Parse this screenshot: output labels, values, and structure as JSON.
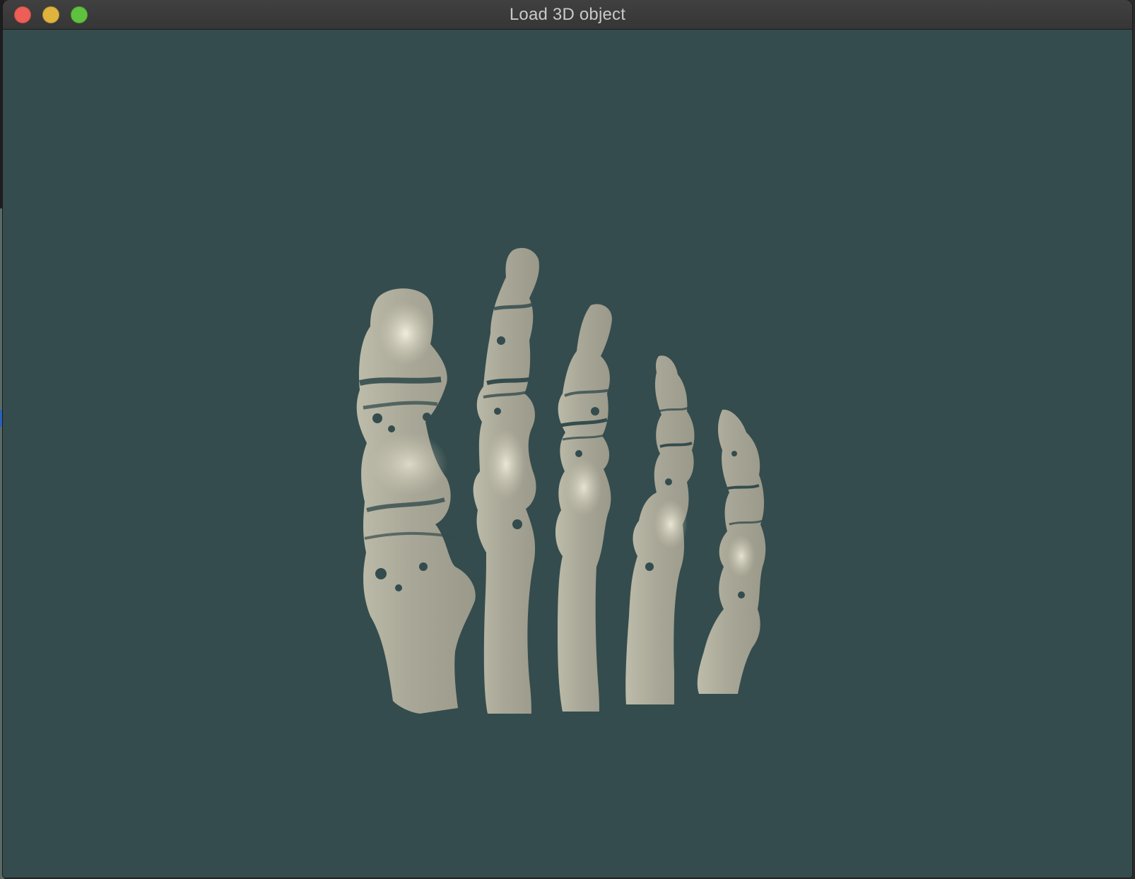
{
  "window": {
    "title": "Load 3D object",
    "controls": {
      "close_icon": "close-icon",
      "minimize_icon": "minimize-icon",
      "zoom_icon": "zoom-icon"
    }
  },
  "viewport": {
    "background_color": "#344c4d",
    "object_color": "#a9a797",
    "highlight_color": "#e7e4d2",
    "object": "foot-bones-3d-model"
  }
}
